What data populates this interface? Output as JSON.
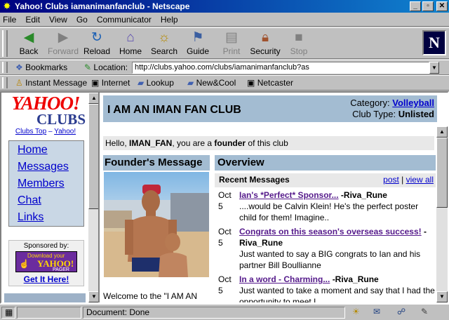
{
  "window": {
    "title": "Yahoo! Clubs iamanimanfanclub - Netscape"
  },
  "menu": [
    "File",
    "Edit",
    "View",
    "Go",
    "Communicator",
    "Help"
  ],
  "toolbar": {
    "back": "Back",
    "forward": "Forward",
    "reload": "Reload",
    "home": "Home",
    "search": "Search",
    "guide": "Guide",
    "print": "Print",
    "security": "Security",
    "stop": "Stop",
    "logo": "N"
  },
  "location": {
    "bookmarks": "Bookmarks",
    "label": "Location:",
    "url": "http://clubs.yahoo.com/clubs/iamanimanfanclub?as"
  },
  "personal": [
    "Instant Message",
    "Internet",
    "Lookup",
    "New&Cool",
    "Netcaster"
  ],
  "left": {
    "logo_top": "YAHOO!",
    "logo_bottom": "CLUBS",
    "clubs_top": "Clubs Top",
    "sep": "–",
    "yahoo_link": "Yahoo!",
    "nav": [
      "Home",
      "Messages",
      "Members",
      "Chat",
      "Links"
    ],
    "sponsored": "Sponsored by:",
    "pager_line1": "Download your",
    "pager_line2": "YAHOO!",
    "pager_line3": "PAGER",
    "get_it": "Get It Here!"
  },
  "club": {
    "name": "I AM AN IMAN FAN CLUB",
    "category_label": "Category:",
    "category_value": "Volleyball",
    "type_label": "Club Type:",
    "type_value": "Unlisted"
  },
  "hello": {
    "pre": "Hello, ",
    "user": "IMAN_FAN",
    "mid": ", you are a ",
    "role": "founder",
    "post": " of this club"
  },
  "founder": {
    "heading": "Founder's Message",
    "welcome": "Welcome to the \"I AM AN"
  },
  "overview": {
    "heading": "Overview",
    "recent": "Recent Messages",
    "post": "post",
    "bar": "|",
    "view_all": "view all",
    "messages": [
      {
        "month": "Oct",
        "day": "5",
        "subject": "Ian's *Perfect* Sponsor...",
        "author": "-Riva_Rune",
        "preview": "....would be Calvin Klein! He's the perfect poster child for them! Imagine.."
      },
      {
        "month": "Oct",
        "day": "5",
        "subject": "Congrats on this season's overseas success!",
        "author": "-Riva_Rune",
        "preview": "Just wanted to say a BIG congrats to Ian and his partner Bill Boullianne"
      },
      {
        "month": "Oct",
        "day": "5",
        "subject": "In a word - Charming...",
        "author": "-Riva_Rune",
        "preview": "Just wanted to take a moment and say that I had the opportunity to meet I"
      }
    ]
  },
  "status": {
    "text": "Document: Done"
  }
}
